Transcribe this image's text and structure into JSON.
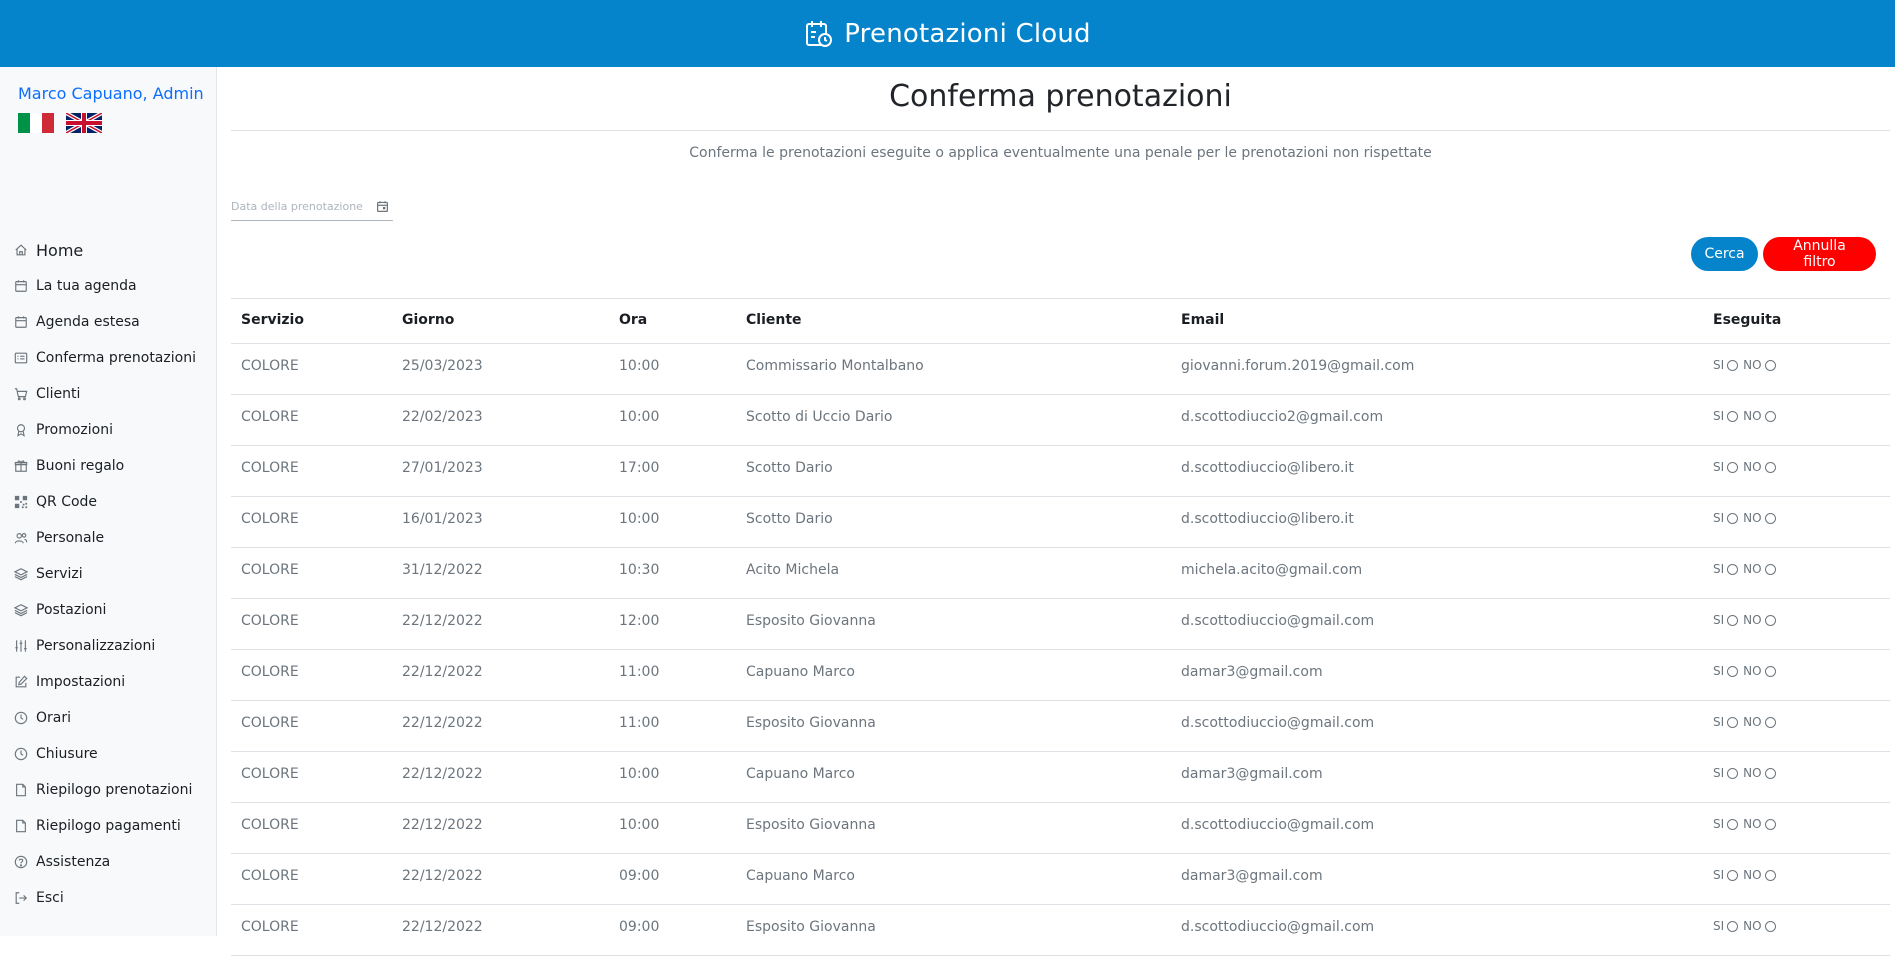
{
  "header": {
    "brand_title": "Prenotazioni Cloud",
    "brand_icon": "calendar-clock-icon",
    "color": "#0584cc"
  },
  "sidebar": {
    "user_label": "Marco Capuano, Admin",
    "languages": [
      "italian-flag",
      "uk-flag"
    ],
    "items": [
      {
        "label": "Home",
        "icon": "home-icon"
      },
      {
        "label": "La tua agenda",
        "icon": "calendar-icon"
      },
      {
        "label": "Agenda estesa",
        "icon": "calendar-icon"
      },
      {
        "label": "Conferma prenotazioni",
        "icon": "list-check-icon"
      },
      {
        "label": "Clienti",
        "icon": "cart-icon"
      },
      {
        "label": "Promozioni",
        "icon": "award-icon"
      },
      {
        "label": "Buoni regalo",
        "icon": "gift-icon"
      },
      {
        "label": "QR Code",
        "icon": "qr-code-icon"
      },
      {
        "label": "Personale",
        "icon": "people-icon"
      },
      {
        "label": "Servizi",
        "icon": "layers-icon"
      },
      {
        "label": "Postazioni",
        "icon": "layers-icon"
      },
      {
        "label": "Personalizzazioni",
        "icon": "sliders-icon"
      },
      {
        "label": "Impostazioni",
        "icon": "edit-icon"
      },
      {
        "label": "Orari",
        "icon": "clock-icon"
      },
      {
        "label": "Chiusure",
        "icon": "clock-icon"
      },
      {
        "label": "Riepilogo prenotazioni",
        "icon": "file-icon"
      },
      {
        "label": "Riepilogo pagamenti",
        "icon": "file-icon"
      },
      {
        "label": "Assistenza",
        "icon": "help-icon"
      },
      {
        "label": "Esci",
        "icon": "logout-icon"
      }
    ]
  },
  "main": {
    "title": "Conferma prenotazioni",
    "subtitle": "Conferma le prenotazioni eseguite o applica eventualmente una penale per le prenotazioni non rispettate",
    "date_filter": {
      "placeholder": "Data della prenotazione",
      "value": ""
    },
    "buttons": {
      "search": "Cerca",
      "clear": "Annulla filtro",
      "search_color": "#0584cc",
      "clear_color": "#ff0000"
    },
    "table": {
      "columns": [
        "Servizio",
        "Giorno",
        "Ora",
        "Cliente",
        "Email",
        "Eseguita"
      ],
      "yes_label": "SI",
      "no_label": "NO",
      "rows": [
        {
          "servizio": "COLORE",
          "giorno": "25/03/2023",
          "ora": "10:00",
          "cliente": "Commissario Montalbano",
          "email": "giovanni.forum.2019@gmail.com"
        },
        {
          "servizio": "COLORE",
          "giorno": "22/02/2023",
          "ora": "10:00",
          "cliente": "Scotto di Uccio Dario",
          "email": "d.scottodiuccio2@gmail.com"
        },
        {
          "servizio": "COLORE",
          "giorno": "27/01/2023",
          "ora": "17:00",
          "cliente": "Scotto Dario",
          "email": "d.scottodiuccio@libero.it"
        },
        {
          "servizio": "COLORE",
          "giorno": "16/01/2023",
          "ora": "10:00",
          "cliente": "Scotto Dario",
          "email": "d.scottodiuccio@libero.it"
        },
        {
          "servizio": "COLORE",
          "giorno": "31/12/2022",
          "ora": "10:30",
          "cliente": "Acito Michela",
          "email": "michela.acito@gmail.com"
        },
        {
          "servizio": "COLORE",
          "giorno": "22/12/2022",
          "ora": "12:00",
          "cliente": "Esposito Giovanna",
          "email": "d.scottodiuccio@gmail.com"
        },
        {
          "servizio": "COLORE",
          "giorno": "22/12/2022",
          "ora": "11:00",
          "cliente": "Capuano Marco",
          "email": "damar3@gmail.com"
        },
        {
          "servizio": "COLORE",
          "giorno": "22/12/2022",
          "ora": "11:00",
          "cliente": "Esposito Giovanna",
          "email": "d.scottodiuccio@gmail.com"
        },
        {
          "servizio": "COLORE",
          "giorno": "22/12/2022",
          "ora": "10:00",
          "cliente": "Capuano Marco",
          "email": "damar3@gmail.com"
        },
        {
          "servizio": "COLORE",
          "giorno": "22/12/2022",
          "ora": "10:00",
          "cliente": "Esposito Giovanna",
          "email": "d.scottodiuccio@gmail.com"
        },
        {
          "servizio": "COLORE",
          "giorno": "22/12/2022",
          "ora": "09:00",
          "cliente": "Capuano Marco",
          "email": "damar3@gmail.com"
        },
        {
          "servizio": "COLORE",
          "giorno": "22/12/2022",
          "ora": "09:00",
          "cliente": "Esposito Giovanna",
          "email": "d.scottodiuccio@gmail.com"
        }
      ]
    }
  }
}
